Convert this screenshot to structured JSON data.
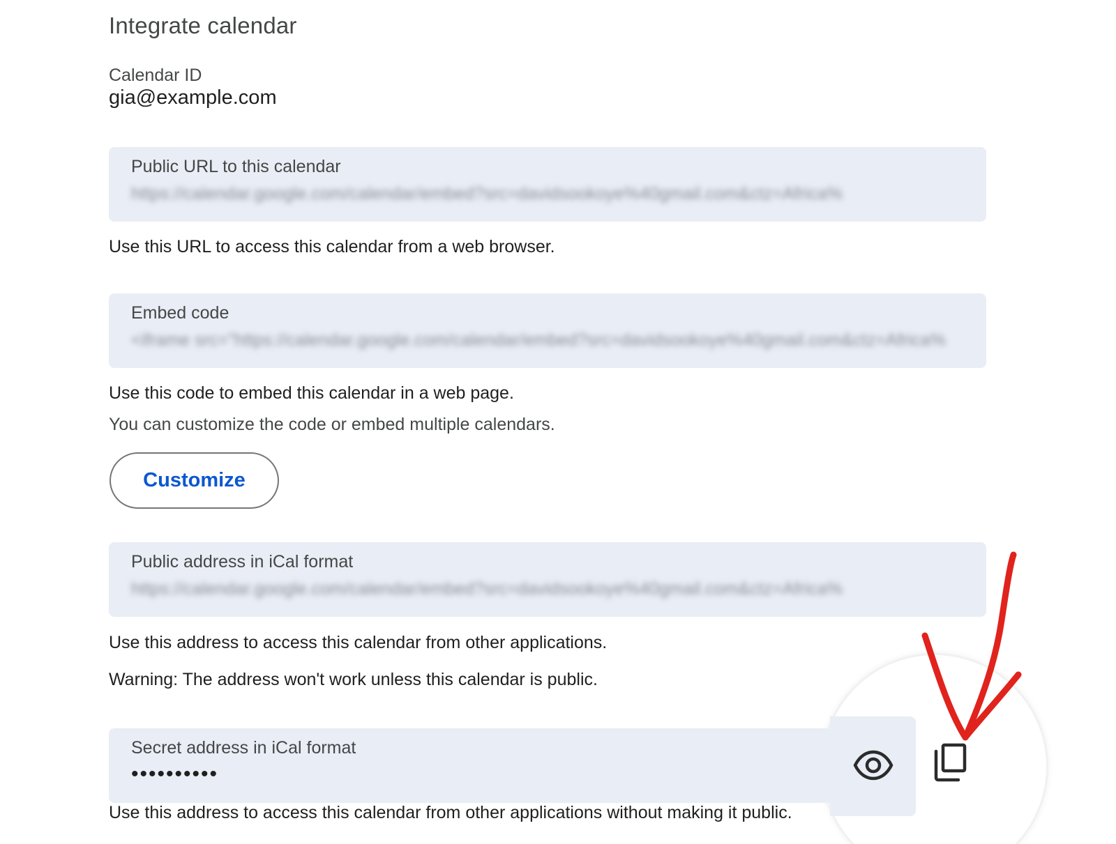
{
  "section": {
    "title": "Integrate calendar"
  },
  "calendar_id": {
    "label": "Calendar ID",
    "value": "gia@example.com"
  },
  "public_url": {
    "label": "Public URL to this calendar",
    "value": "https://calendar.google.com/calendar/embed?src=davidsookoye%40gmail.com&ctz=Africa%",
    "help": "Use this URL to access this calendar from a web browser."
  },
  "embed_code": {
    "label": "Embed code",
    "value": "<iframe src=\"https://calendar.google.com/calendar/embed?src=davidsookoye%40gmail.com&ctz=Africa%",
    "help": "Use this code to embed this calendar in a web page.",
    "help_secondary": "You can customize the code or embed multiple calendars.",
    "customize_label": "Customize"
  },
  "public_ical": {
    "label": "Public address in iCal format",
    "value": "https://calendar.google.com/calendar/embed?src=davidsookoye%40gmail.com&ctz=Africa%",
    "help": "Use this address to access this calendar from other applications.",
    "warning": "Warning: The address won't work unless this calendar is public."
  },
  "secret_ical": {
    "label": "Secret address in iCal format",
    "value": "••••••••••",
    "help": "Use this address to access this calendar from other applications without making it public.",
    "reveal_icon": "eye-icon",
    "copy_icon": "copy-icon"
  },
  "colors": {
    "field_background": "#e9edf5",
    "accent_blue": "#0b57d0",
    "annotation_red": "#e0231c"
  }
}
